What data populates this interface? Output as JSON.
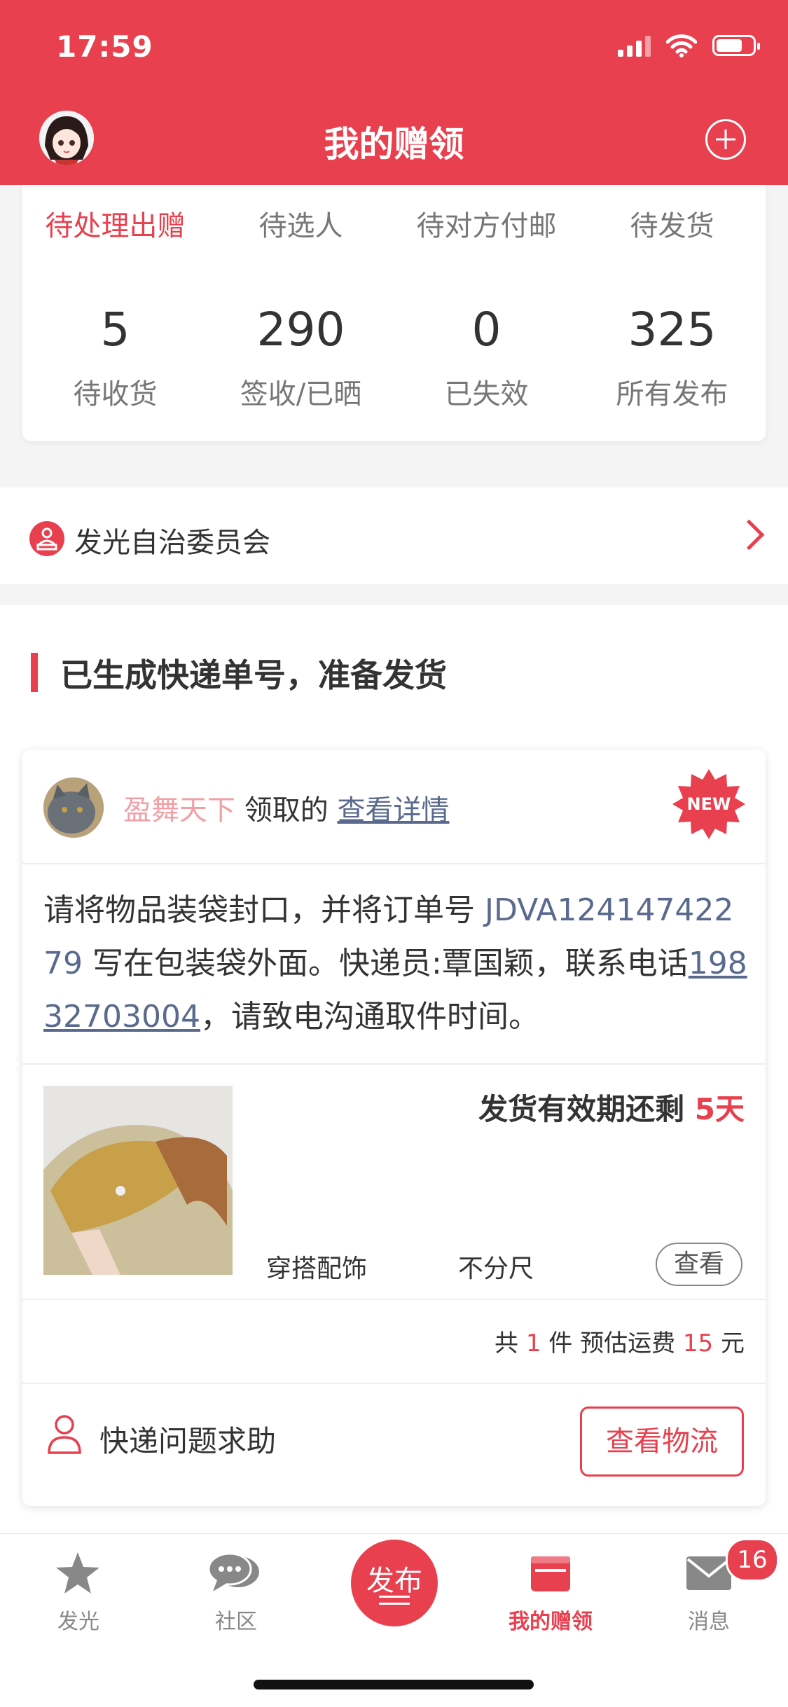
{
  "status_bar": {
    "time": "17:59"
  },
  "header": {
    "title": "我的赠领"
  },
  "order_tabs": [
    "待处理出赠",
    "待选人",
    "待对方付邮",
    "待发货"
  ],
  "stats": [
    {
      "value": "5",
      "label": "待收货"
    },
    {
      "value": "290",
      "label": "签收/已晒"
    },
    {
      "value": "0",
      "label": "已失效"
    },
    {
      "value": "325",
      "label": "所有发布"
    }
  ],
  "committee": {
    "label": "发光自治委员会"
  },
  "section": {
    "title": "已生成快递单号，准备发货"
  },
  "card": {
    "user_name": "盈舞天下",
    "claimed_text": " 领取的 ",
    "detail_link": "查看详情",
    "new_badge": "NEW",
    "msg_part1": "请将物品装袋封口，并将订单号 ",
    "order_no": "JDVA12414742279",
    "msg_part2": " 写在包装袋外面。快递员:覃国颖，联系电话",
    "phone": "19832703004",
    "msg_part3": "，请致电沟通取件时间。",
    "deadline_prefix": "发货有效期还剩 ",
    "deadline_days": "5天",
    "category": "穿搭配饰",
    "size": "不分尺",
    "view_label": "查看",
    "summary_prefix": "共 ",
    "summary_count": "1",
    "summary_mid": " 件 预估运费 ",
    "summary_fee": "15",
    "summary_suffix": " 元",
    "help_label": "快递问题求助",
    "logistics_label": "查看物流"
  },
  "tabbar": {
    "items": [
      {
        "label": "发光"
      },
      {
        "label": "社区"
      },
      {
        "label": "发布"
      },
      {
        "label": "我的赠领"
      },
      {
        "label": "消息"
      }
    ],
    "message_badge": "16"
  },
  "colors": {
    "accent": "#e8404f",
    "link": "#5a6a8e"
  }
}
